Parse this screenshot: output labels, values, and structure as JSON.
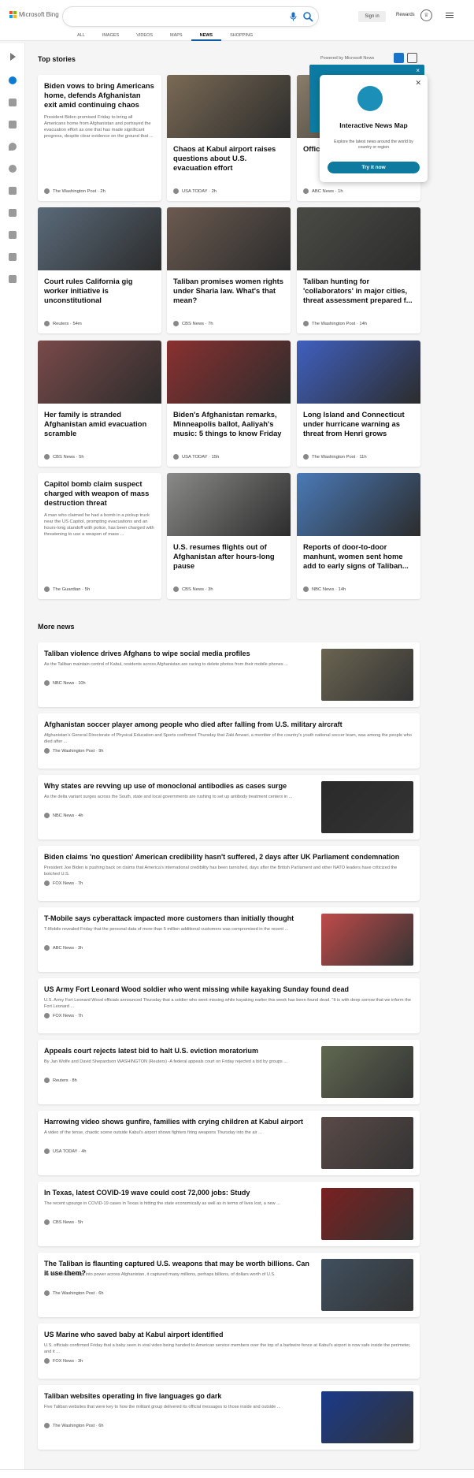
{
  "header": {
    "brand": "Microsoft Bing",
    "search_placeholder": "",
    "signin_label": "Sign in",
    "rewards_label": "Rewards"
  },
  "nav": {
    "items": [
      "ALL",
      "IMAGES",
      "VIDEOS",
      "MAPS",
      "NEWS",
      "SHOPPING"
    ],
    "active": "NEWS"
  },
  "top": {
    "title": "Top stories",
    "powered": "Powered by Microsoft News"
  },
  "popup": {
    "title": "Interactive News Map",
    "desc": "Explore the latest news around the world by country or region",
    "button": "Try it now"
  },
  "cards": [
    {
      "title": "Biden vows to bring Americans home, defends Afghanistan exit amid continuing chaos",
      "desc": "President Biden promised Friday to bring all Americans home from Afghanistan and portrayed the evacuation effort as one that has made significant progress, despite clear evidence on the ground that ...",
      "source": "The Washington Post · 2h"
    },
    {
      "title": "Chaos at Kabul airport raises questions about U.S. evacuation effort",
      "desc": "",
      "source": "USA TODAY · 2h"
    },
    {
      "title": "Offic livest COVI",
      "desc": "",
      "source": "ABC News · 1h"
    },
    {
      "title": "Court rules California gig worker initiative is unconstitutional",
      "desc": "",
      "source": "Reuters · 54m"
    },
    {
      "title": "Taliban promises women rights under Sharia law. What's that mean?",
      "desc": "",
      "source": "CBS News · 7h"
    },
    {
      "title": "Taliban hunting for 'collaborators' in major cities, threat assessment prepared f...",
      "desc": "",
      "source": "The Washington Post · 14h"
    },
    {
      "title": "Her family is stranded Afghanistan amid evacuation scramble",
      "desc": "",
      "source": "CBS News · 5h"
    },
    {
      "title": "Biden's Afghanistan remarks, Minneapolis ballot, Aaliyah's music: 5 things to know Friday",
      "desc": "",
      "source": "USA TODAY · 15h"
    },
    {
      "title": "Long Island and Connecticut under hurricane warning as threat from Henri grows",
      "desc": "",
      "source": "The Washington Post · 11h"
    },
    {
      "title": "Capitol bomb claim suspect charged with weapon of mass destruction threat",
      "desc": "A man who claimed he had a bomb in a pickup truck near the US Capitol, prompting evacuations and an hours-long standoff with police, has been charged with threatening to use a weapon of mass ...",
      "source": "The Guardian · 5h"
    },
    {
      "title": "U.S. resumes flights out of Afghanistan after hours-long pause",
      "desc": "",
      "source": "CBS News · 3h"
    },
    {
      "title": "Reports of door-to-door manhunt, women sent home add to early signs of Taliban...",
      "desc": "",
      "source": "NBC News · 14h"
    }
  ],
  "more": {
    "title": "More news",
    "items": [
      {
        "title": "Taliban violence drives Afghans to wipe social media profiles",
        "desc": "As the Taliban maintain control of Kabul, residents across Afghanistan are racing to delete photos from their mobile phones ...",
        "source": "NBC News · 10h",
        "img": true
      },
      {
        "title": "Afghanistan soccer player among people who died after falling from U.S. military aircraft",
        "desc": "Afghanistan's General Directorate of Physical Education and Sports confirmed Thursday that Zaki Anwari, a member of the country's youth national soccer team, was among the people who died after ...",
        "source": "The Washington Post · 9h",
        "img": false
      },
      {
        "title": "Why states are revving up use of monoclonal antibodies as cases surge",
        "desc": "As the delta variant surges across the South, state and local governments are rushing to set up antibody treatment centers in ...",
        "source": "NBC News · 4h",
        "img": true
      },
      {
        "title": "Biden claims 'no question' American credibility hasn't suffered, 2 days after UK Parliament condemnation",
        "desc": "President Joe Biden is pushing back on claims that America's international credibility has been tarnished, days after the British Parliament and other NATO leaders have criticized the botched U.S.",
        "source": "FOX News · 7h",
        "img": false
      },
      {
        "title": "T-Mobile says cyberattack impacted more customers than initially thought",
        "desc": "T-Mobile revealed Friday that the personal data of more than 5 million additional customers was compromised in the recent ...",
        "source": "ABC News · 3h",
        "img": true
      },
      {
        "title": "US Army Fort Leonard Wood soldier who went missing while kayaking Sunday found dead",
        "desc": "U.S. Army Fort Leonard Wood officials announced Thursday that a soldier who went missing while kayaking earlier this week has been found dead. \"It is with deep sorrow that we inform the Fort Leonard ...",
        "source": "FOX News · 7h",
        "img": false
      },
      {
        "title": "Appeals court rejects latest bid to halt U.S. eviction moratorium",
        "desc": "By Jan Wolfe and David Shepardson WASHINGTON (Reuters) -A federal appeals court on Friday rejected a bid by groups ...",
        "source": "Reuters · 8h",
        "img": true
      },
      {
        "title": "Harrowing video shows gunfire, families with crying children at Kabul airport",
        "desc": "A video of the tense, chaotic scene outside Kabul's airport shows fighters firing weapons Thursday into the air ...",
        "source": "USA TODAY · 4h",
        "img": true
      },
      {
        "title": "In Texas, latest COVID-19 wave could cost 72,000 jobs: Study",
        "desc": "The recent upsurge in COVID-19 cases in Texas is hitting the state economically as well as in terms of lives lost, a new ...",
        "source": "CBS News · 5h",
        "img": true
      },
      {
        "title": "The Taliban is flaunting captured U.S. weapons that may be worth billions. Can it use them?",
        "desc": "As the Taliban swept into power across Afghanistan, it captured many millions, perhaps billions, of dollars worth of U.S.",
        "source": "The Washington Post · 6h",
        "img": true
      },
      {
        "title": "US Marine who saved baby at Kabul airport identified",
        "desc": "U.S. officials confirmed Friday that a baby seen in viral video being handed to American service members over the top of a barbwire fence at Kabul's airport is now safe inside the perimeter, and it ...",
        "source": "FOX News · 3h",
        "img": false
      },
      {
        "title": "Taliban websites operating in five languages go dark",
        "desc": "Five Taliban websites that were key to how the militant group delivered its official messages to those inside and outside ...",
        "source": "The Washington Post · 6h",
        "img": true
      }
    ]
  },
  "colors": {
    "accent": "#0c59a4",
    "teal": "#0f7a9f"
  }
}
